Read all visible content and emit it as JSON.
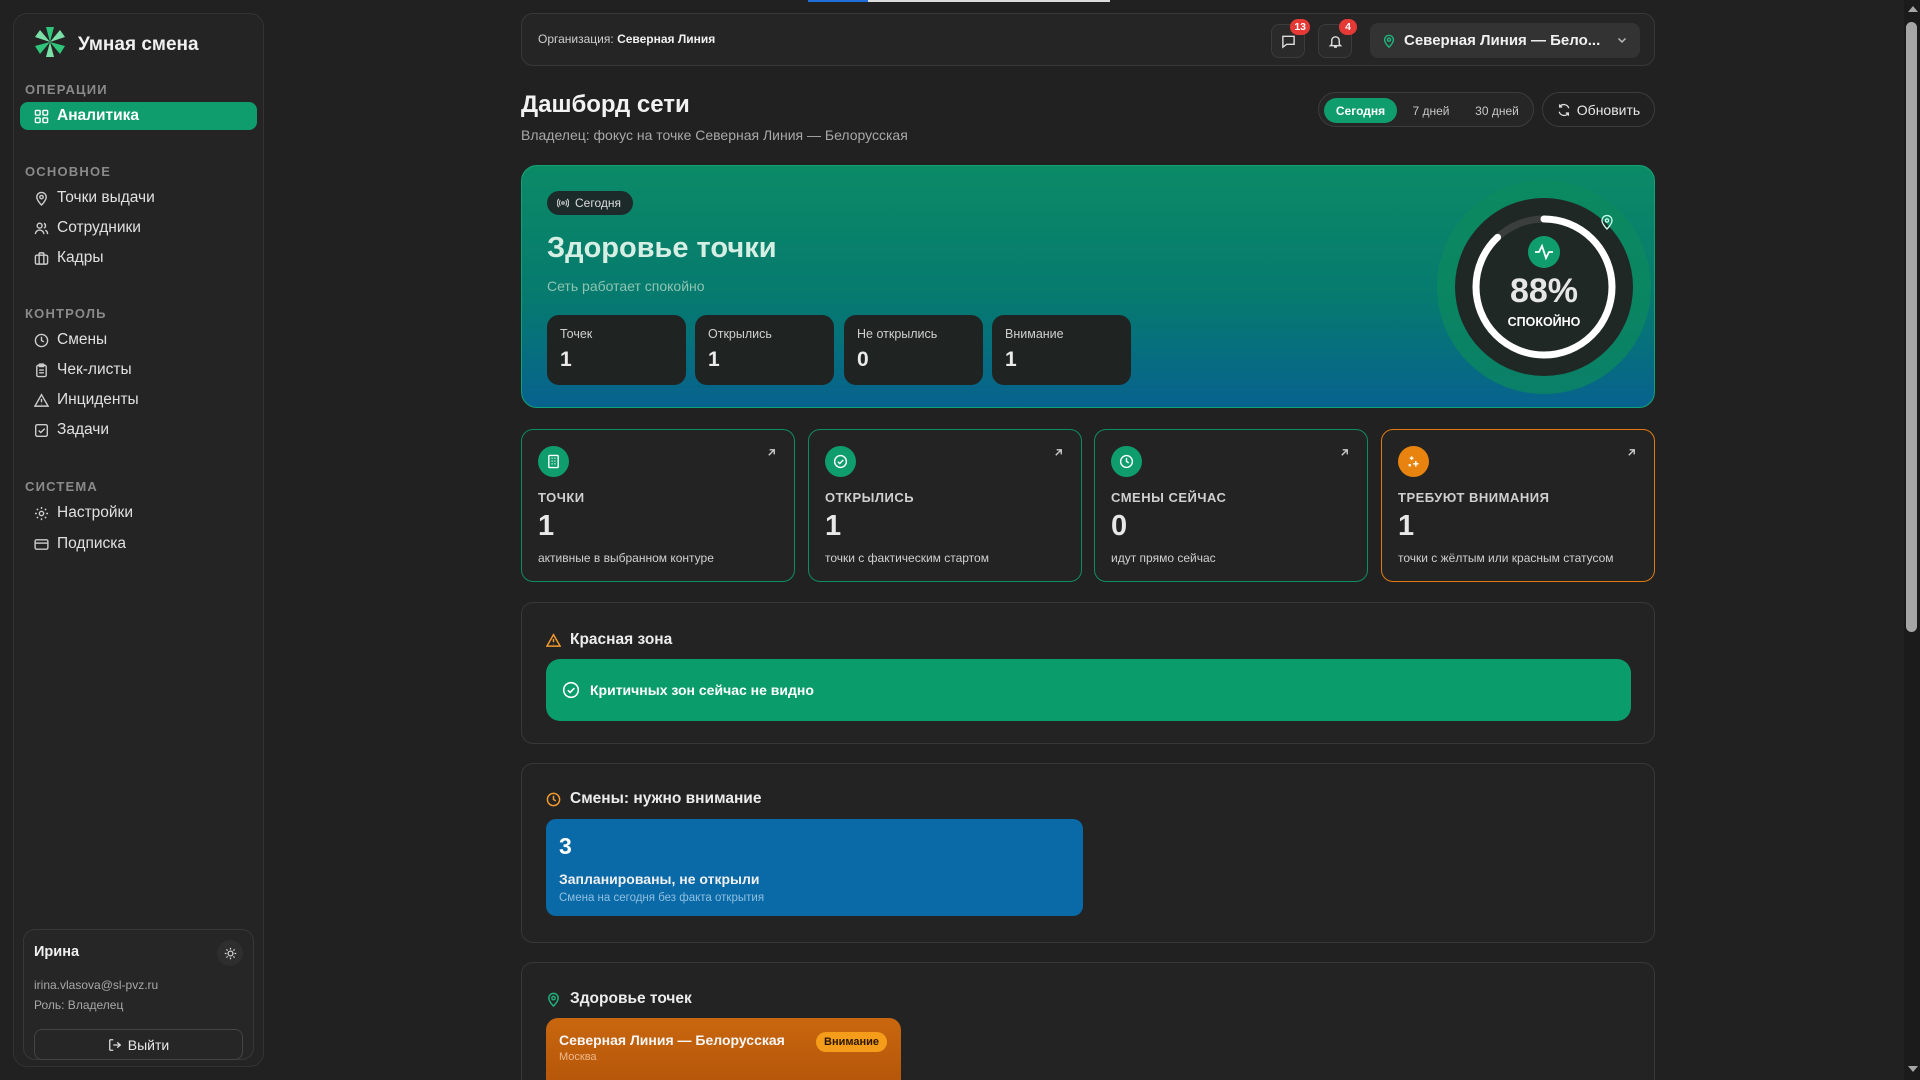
{
  "app": {
    "name": "Умная смена"
  },
  "sidebar": {
    "sections": [
      {
        "title": "ОПЕРАЦИИ",
        "items": [
          {
            "label": "Аналитика",
            "icon": "grid-icon",
            "active": true
          }
        ]
      },
      {
        "title": "ОСНОВНОЕ",
        "items": [
          {
            "label": "Точки выдачи",
            "icon": "map-pin-icon"
          },
          {
            "label": "Сотрудники",
            "icon": "users-icon"
          },
          {
            "label": "Кадры",
            "icon": "briefcase-icon"
          }
        ]
      },
      {
        "title": "КОНТРОЛЬ",
        "items": [
          {
            "label": "Смены",
            "icon": "clock-icon"
          },
          {
            "label": "Чек-листы",
            "icon": "clipboard-icon"
          },
          {
            "label": "Инциденты",
            "icon": "alert-triangle-icon"
          },
          {
            "label": "Задачи",
            "icon": "check-square-icon"
          }
        ]
      },
      {
        "title": "СИСТЕМА",
        "items": [
          {
            "label": "Настройки",
            "icon": "gear-icon"
          },
          {
            "label": "Подписка",
            "icon": "credit-card-icon"
          }
        ]
      }
    ]
  },
  "user": {
    "name": "Ирина",
    "email": "irina.vlasova@sl-pvz.ru",
    "role": "Роль: Владелец",
    "logout_label": "Выйти"
  },
  "topbar": {
    "org_label": "Организация:",
    "org_name": "Северная Линия",
    "messages_count": "13",
    "notifications_count": "4",
    "location": "Северная Линия — Бело..."
  },
  "header": {
    "title": "Дашборд сети",
    "subtitle": "Владелец: фокус на точке Северная Линия — Белорусская",
    "ranges": [
      "Сегодня",
      "7 дней",
      "30 дней"
    ],
    "active_range": "Сегодня",
    "refresh_label": "Обновить"
  },
  "hero": {
    "chip": "Сегодня",
    "title": "Здоровье точки",
    "subtitle": "Сеть работает спокойно",
    "stats": [
      {
        "label": "Точек",
        "value": "1"
      },
      {
        "label": "Открылись",
        "value": "1"
      },
      {
        "label": "Не открылись",
        "value": "0"
      },
      {
        "label": "Внимание",
        "value": "1"
      }
    ],
    "gauge": {
      "value_text": "88%",
      "status": "СПОКОЙНО",
      "fraction": 0.88
    }
  },
  "kpis": [
    {
      "label": "ТОЧКИ",
      "value": "1",
      "desc": "активные в выбранном контуре",
      "icon": "building-icon",
      "warn": false
    },
    {
      "label": "ОТКРЫЛИСЬ",
      "value": "1",
      "desc": "точки с фактическим стартом",
      "icon": "check-circle-icon",
      "warn": false
    },
    {
      "label": "СМЕНЫ СЕЙЧАС",
      "value": "0",
      "desc": "идут прямо сейчас",
      "icon": "clock-icon",
      "warn": false
    },
    {
      "label": "ТРЕБУЮТ ВНИМАНИЯ",
      "value": "1",
      "desc": "точки с жёлтым или красным статусом",
      "icon": "sparkles-icon",
      "warn": true
    }
  ],
  "red_zone": {
    "title": "Красная зона",
    "message": "Критичных зон сейчас не видно"
  },
  "shifts": {
    "title": "Смены: нужно внимание",
    "count": "3",
    "card_title": "Запланированы, не открыли",
    "card_desc": "Смена на сегодня без факта открытия"
  },
  "points_health": {
    "title": "Здоровье точек",
    "point_name": "Северная Линия — Белорусская",
    "city": "Москва",
    "status": "Внимание"
  },
  "colors": {
    "accent": "#0f9d6e",
    "warning": "#e8830f",
    "info": "#0a6aa8",
    "background": "#212121"
  }
}
